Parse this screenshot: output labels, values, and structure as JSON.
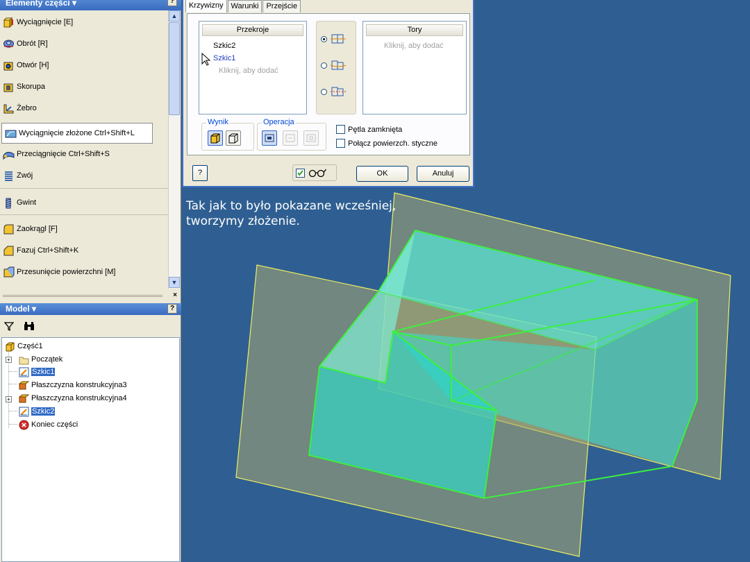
{
  "features_panel": {
    "title": "Elementy części ▾",
    "help": "?",
    "items": [
      {
        "label": "Wyciągnięcie   [E]",
        "icon": "extrude-icon"
      },
      {
        "label": "Obrót   [R]",
        "icon": "revolve-icon"
      },
      {
        "label": "Otwór   [H]",
        "icon": "hole-icon"
      },
      {
        "label": "Skorupa",
        "icon": "shell-icon"
      },
      {
        "label": "Żebro",
        "icon": "rib-icon"
      },
      {
        "label": "Wyciągnięcie złożone   Ctrl+Shift+L",
        "icon": "loft-icon"
      },
      {
        "label": "Przeciągnięcie   Ctrl+Shift+S",
        "icon": "sweep-icon"
      },
      {
        "label": "Zwój",
        "icon": "coil-icon"
      },
      {
        "label": "Gwint",
        "icon": "thread-icon"
      },
      {
        "label": "Zaokrągl   [F]",
        "icon": "fillet-icon"
      },
      {
        "label": "Fazuj   Ctrl+Shift+K",
        "icon": "chamfer-icon"
      },
      {
        "label": "Przesunięcie powierzchni   [M]",
        "icon": "face-offset-icon"
      }
    ],
    "selected_index": 5
  },
  "model_panel": {
    "title": "Model ▾",
    "help": "?",
    "tree": [
      {
        "label": "Część1",
        "icon": "part-icon",
        "expander": ""
      },
      {
        "label": "Początek",
        "icon": "folder-icon",
        "expander": "+"
      },
      {
        "label": "Szkic1",
        "icon": "sketch-icon",
        "expander": "",
        "highlighted": true
      },
      {
        "label": "Płaszczyzna konstrukcyjna3",
        "icon": "work-plane-icon",
        "expander": ""
      },
      {
        "label": "Płaszczyzna konstrukcyjna4",
        "icon": "work-plane-icon",
        "expander": "+"
      },
      {
        "label": "Szkic2",
        "icon": "sketch-icon",
        "expander": "",
        "highlighted": true
      },
      {
        "label": "Koniec części",
        "icon": "end-of-part-icon",
        "expander": ""
      }
    ]
  },
  "dialog": {
    "tabs": [
      "Krzywizny",
      "Warunki",
      "Przejście"
    ],
    "active_tab": 0,
    "sections_header": "Przekroje",
    "sections": [
      "Szkic2",
      "Szkic1"
    ],
    "sections_add": "Kliknij, aby dodać",
    "rails_header": "Tory",
    "rails_add": "Kliknij, aby dodać",
    "mode_selected": 0,
    "result_label": "Wynik",
    "operation_label": "Operacja",
    "closed_loop": "Pętla zamknięta",
    "merge_tangent": "Połącz powierzch. styczne",
    "ok": "OK",
    "cancel": "Anuluj",
    "help": "?"
  },
  "viewport": {
    "caption": "Tak jak to było pokazane wcześniej,\ntworzymy złożenie."
  },
  "colors": {
    "viewport_bg": "#2f5f92",
    "solid_fill": "#40d8c8",
    "edge_highlight": "#3df03d",
    "work_plane": "#f0f060",
    "selection": "#316ac5"
  }
}
